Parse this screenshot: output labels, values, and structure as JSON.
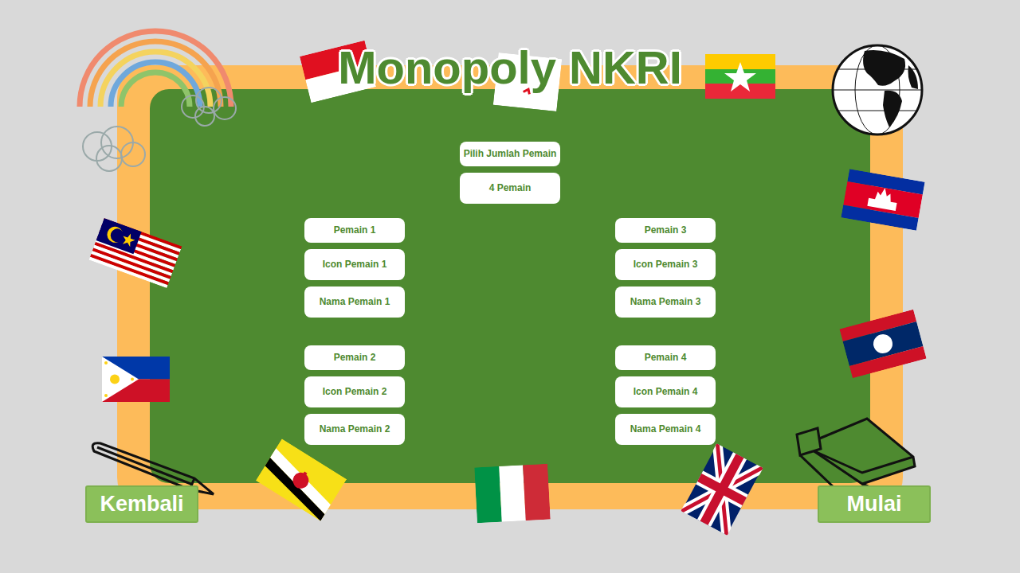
{
  "title": "Monopoly NKRI",
  "player_count": {
    "label": "Pilih Jumlah Pemain",
    "value": "4 Pemain"
  },
  "players": [
    {
      "label": "Pemain 1",
      "icon": "Icon Pemain 1",
      "name": "Nama Pemain 1"
    },
    {
      "label": "Pemain 2",
      "icon": "Icon Pemain 2",
      "name": "Nama Pemain 2"
    },
    {
      "label": "Pemain 3",
      "icon": "Icon Pemain 3",
      "name": "Nama Pemain 3"
    },
    {
      "label": "Pemain 4",
      "icon": "Icon Pemain 4",
      "name": "Nama Pemain 4"
    }
  ],
  "buttons": {
    "back": "Kembali",
    "start": "Mulai"
  }
}
